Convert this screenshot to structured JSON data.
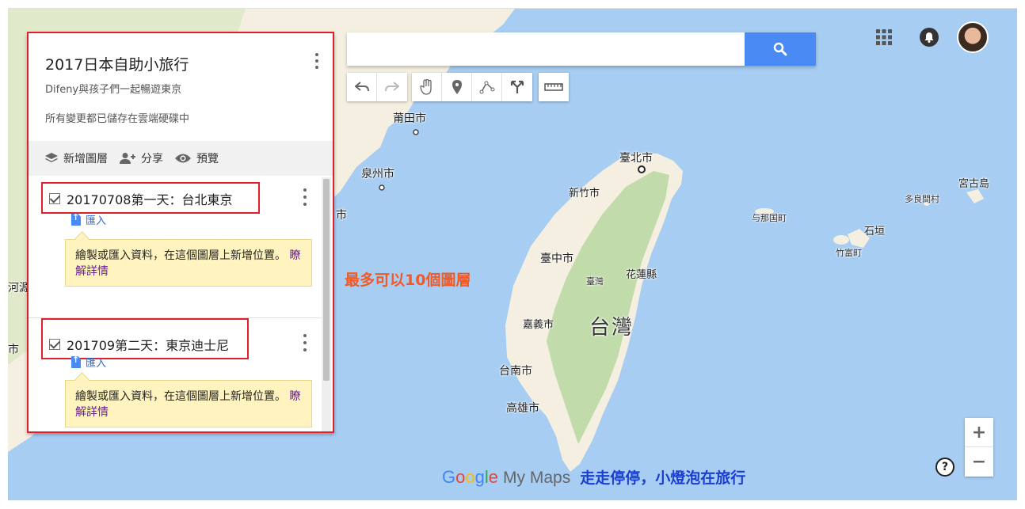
{
  "panel": {
    "title": "2017日本自助小旅行",
    "subtitle": "Difeny與孩子們一起暢遊東京",
    "saved_status": "所有變更都已儲存在雲端硬碟中",
    "toolbar": {
      "add_layer": "新增圖層",
      "share": "分享",
      "preview": "預覽"
    },
    "layers": [
      {
        "name": "20170708第一天：台北東京",
        "import_label": "匯入",
        "tip_text": "繪製或匯入資料，在這個圖層上新增位置。",
        "tip_link": "瞭解詳情"
      },
      {
        "name": "201709第二天：東京迪士尼",
        "import_label": "匯入",
        "tip_text": "繪製或匯入資料，在這個圖層上新增位置。",
        "tip_link": "瞭解詳情"
      }
    ]
  },
  "annotation": "最多可以10個圖層",
  "search": {
    "placeholder": ""
  },
  "map_labels": {
    "putian": "莆田市",
    "quanzhou": "泉州市",
    "edge_shi1": "市",
    "edge_heyuan": "河源",
    "edge_shi2": "市",
    "taipei": "臺北市",
    "hsinchu": "新竹市",
    "taichung": "臺中市",
    "taiwan_small": "臺灣",
    "hualien": "花蓮縣",
    "chiayi": "嘉義市",
    "taiwan_big": "台灣",
    "tainan": "台南市",
    "kaohsiung": "高雄市",
    "yonaguni": "与那国町",
    "taketomi": "竹富町",
    "ishigaki": "石垣",
    "tarama": "多良間村",
    "miyakojima": "宮古島"
  },
  "brand": {
    "google": "Google",
    "my_maps": "My Maps",
    "footer_text": "走走停停，小燈泡在旅行"
  },
  "zoom": {
    "plus": "+",
    "minus": "−"
  },
  "help": "?",
  "colors": {
    "water": "#a7cdf2",
    "land": "#f4efe1",
    "green": "#b9d7a0",
    "accent_red": "#e0202a",
    "search_blue": "#4a8af4",
    "annotation_orange": "#f05a28",
    "footer_blue": "#1a3ed0"
  }
}
